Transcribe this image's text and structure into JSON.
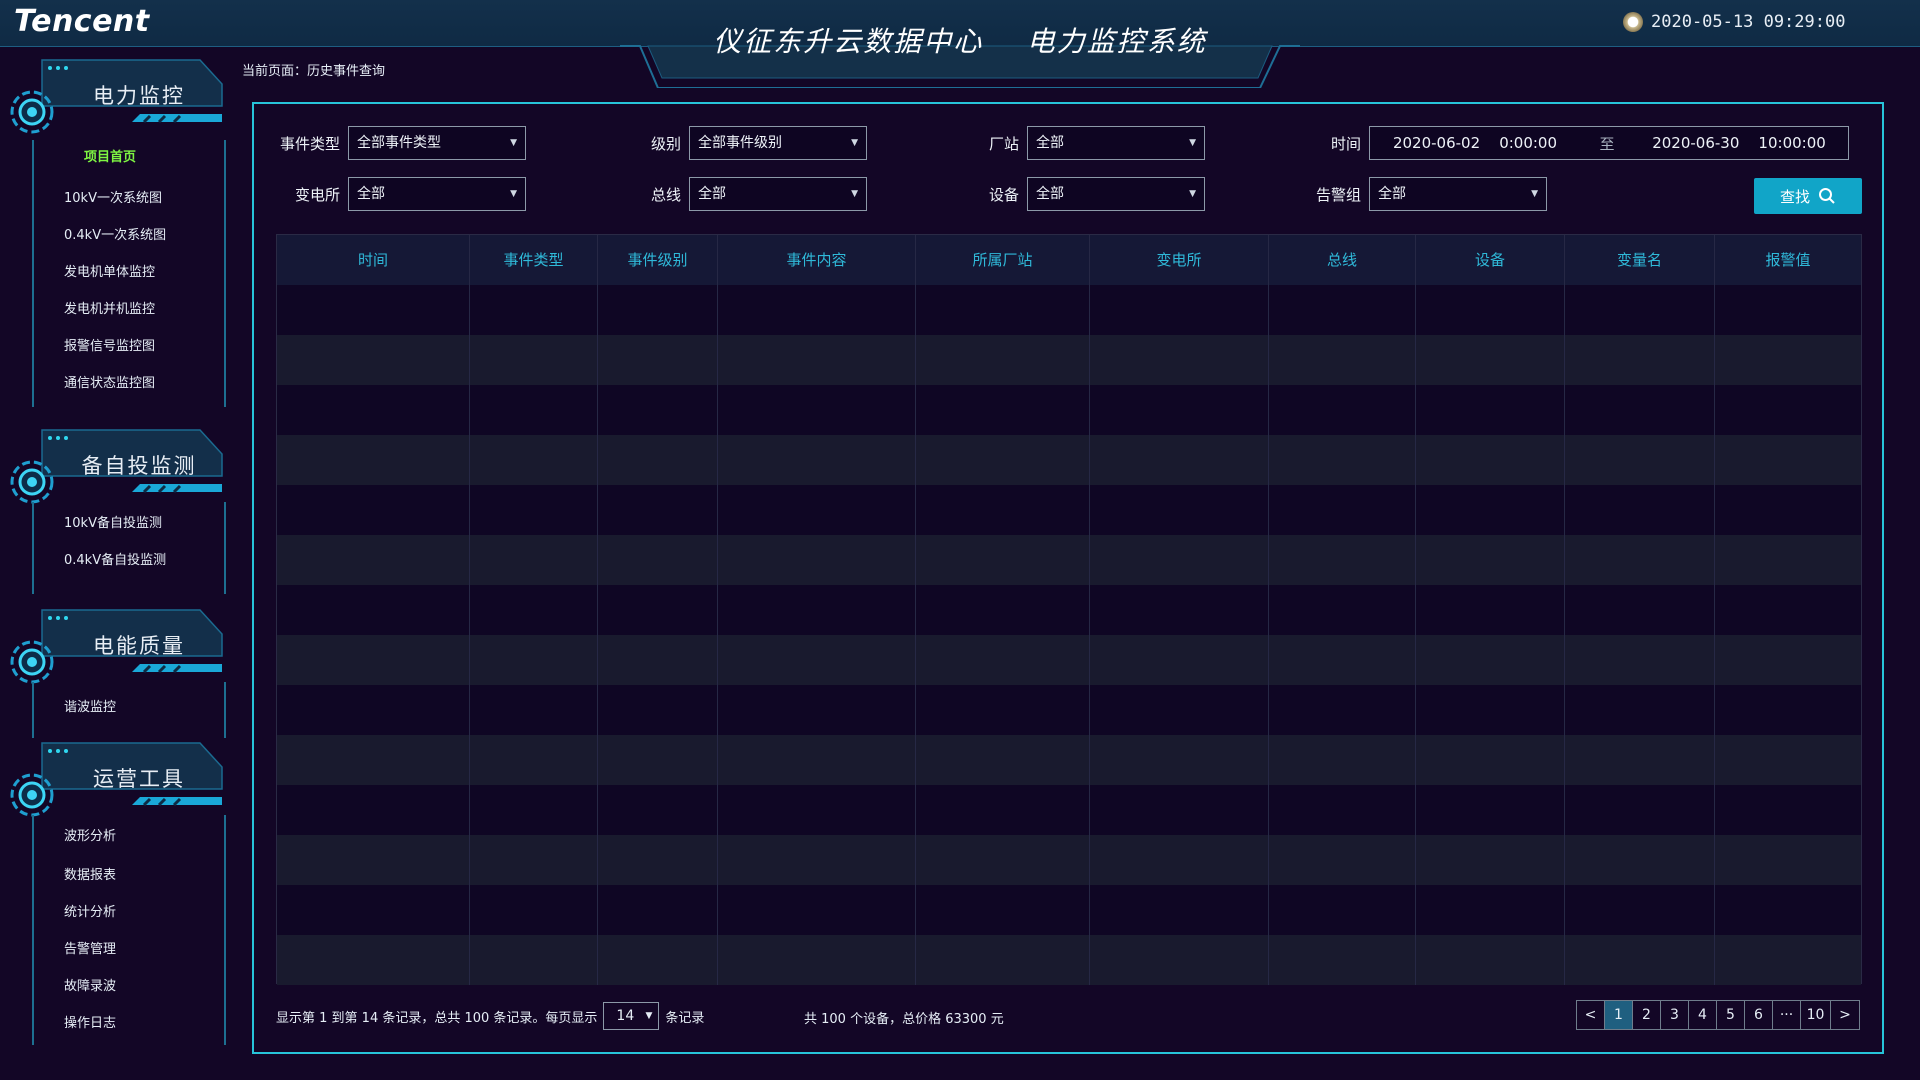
{
  "header": {
    "logo": "Tencent",
    "title": "仪征东升云数据中心    电力监控系统",
    "datetime": "2020-05-13  09:29:00"
  },
  "breadcrumb": "当前页面：历史事件查询",
  "sidebar": {
    "sections": [
      {
        "title": "电力监控",
        "items": [
          {
            "label": "项目首页",
            "active": true
          },
          {
            "label": "10kV一次系统图"
          },
          {
            "label": "0.4kV一次系统图"
          },
          {
            "label": "发电机单体监控"
          },
          {
            "label": "发电机并机监控"
          },
          {
            "label": "报警信号监控图"
          },
          {
            "label": "通信状态监控图"
          }
        ]
      },
      {
        "title": "备自投监测",
        "items": [
          {
            "label": "10kV备自投监测"
          },
          {
            "label": "0.4kV备自投监测"
          }
        ]
      },
      {
        "title": "电能质量",
        "items": [
          {
            "label": "谐波监控"
          }
        ]
      },
      {
        "title": "运营工具",
        "items": [
          {
            "label": "波形分析"
          },
          {
            "label": "数据报表"
          },
          {
            "label": "统计分析"
          },
          {
            "label": "告警管理"
          },
          {
            "label": "故障录波"
          },
          {
            "label": "操作日志"
          }
        ]
      }
    ]
  },
  "filters": {
    "event_type": {
      "label": "事件类型",
      "value": "全部事件类型"
    },
    "level": {
      "label": "级别",
      "value": "全部事件级别"
    },
    "plant": {
      "label": "厂站",
      "value": "全部"
    },
    "time": {
      "label": "时间",
      "start": "2020-06-02    0:00:00",
      "separator": "至",
      "end": "2020-06-30    10:00:00"
    },
    "substation": {
      "label": "变电所",
      "value": "全部"
    },
    "bus": {
      "label": "总线",
      "value": "全部"
    },
    "device": {
      "label": "设备",
      "value": "全部"
    },
    "alarm_group": {
      "label": "告警组",
      "value": "全部"
    },
    "search_label": "查找"
  },
  "table": {
    "columns": [
      "时间",
      "事件类型",
      "事件级别",
      "事件内容",
      "所属厂站",
      "变电所",
      "总线",
      "设备",
      "变量名",
      "报警值"
    ],
    "row_count": 14
  },
  "footer": {
    "range_text": "显示第 1 到第 14  条记录，总共 100 条记录。每页显示",
    "page_size": "14",
    "records_suffix": "条记录",
    "summary": "共 100 个设备，总价格 63300 元"
  },
  "pagination": {
    "prev": "<",
    "pages": [
      "1",
      "2",
      "3",
      "4",
      "5",
      "6",
      "···",
      "10"
    ],
    "current": "1",
    "next": ">"
  },
  "colors": {
    "background": "#130626",
    "accent": "#27c3d9",
    "header_text": "#2fb9d9",
    "active_nav": "#7ef542",
    "button": "#11a5c8"
  }
}
